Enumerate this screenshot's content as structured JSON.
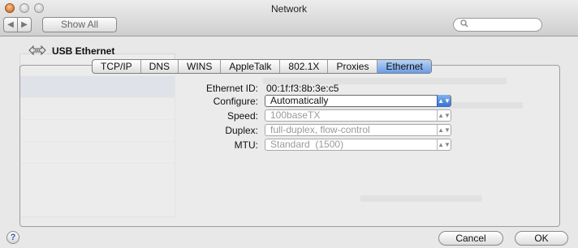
{
  "window": {
    "title": "Network"
  },
  "toolbar": {
    "back_glyph": "◀",
    "forward_glyph": "▶",
    "show_all_label": "Show All",
    "search_placeholder": ""
  },
  "icons": {
    "search": "search-icon",
    "usb": "usb-ethernet-icon",
    "help": "help-icon"
  },
  "device": {
    "name": "USB Ethernet"
  },
  "tabs": [
    {
      "label": "TCP/IP",
      "active": false
    },
    {
      "label": "DNS",
      "active": false
    },
    {
      "label": "WINS",
      "active": false
    },
    {
      "label": "AppleTalk",
      "active": false
    },
    {
      "label": "802.1X",
      "active": false
    },
    {
      "label": "Proxies",
      "active": false
    },
    {
      "label": "Ethernet",
      "active": true
    }
  ],
  "ethernet": {
    "ethernet_id_label": "Ethernet ID:",
    "ethernet_id_value": "00:1f:f3:8b:3e:c5",
    "configure_label": "Configure:",
    "configure_value": "Automatically",
    "speed_label": "Speed:",
    "speed_value": "100baseTX",
    "duplex_label": "Duplex:",
    "duplex_value": "full-duplex, flow-control",
    "mtu_label": "MTU:",
    "mtu_value": "Standard  (1500)"
  },
  "buttons": {
    "help_label": "?",
    "cancel_label": "Cancel",
    "ok_label": "OK"
  },
  "colors": {
    "tab_active": "#6a9de6",
    "popup_arrow": "#2f6fd4",
    "help_glyph": "#3f5fa8"
  }
}
